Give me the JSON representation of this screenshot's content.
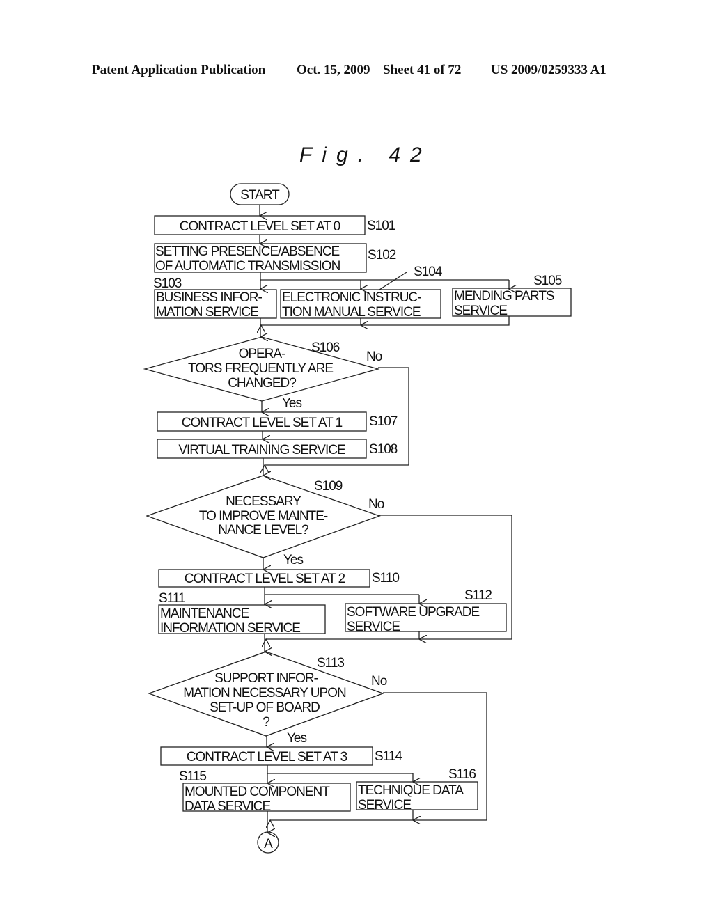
{
  "header": {
    "left": "Patent Application Publication",
    "date": "Oct. 15, 2009",
    "sheet": "Sheet 41 of 72",
    "number": "US 2009/0259333 A1"
  },
  "figure": {
    "title": "Fig. 42"
  },
  "flow": {
    "start": "START",
    "s101": {
      "id": "S101",
      "text": "CONTRACT LEVEL SET AT 0"
    },
    "s102": {
      "id": "S102",
      "lines": [
        "SETTING PRESENCE/ABSENCE",
        "OF AUTOMATIC TRANSMISSION"
      ]
    },
    "s103": {
      "id": "S103",
      "lines": [
        "BUSINESS INFOR-",
        "MATION SERVICE"
      ]
    },
    "s104": {
      "id": "S104",
      "lines": [
        "ELECTRONIC INSTRUC-",
        "TION MANUAL SERVICE"
      ]
    },
    "s105": {
      "id": "S105",
      "lines": [
        "MENDING PARTS",
        "SERVICE"
      ]
    },
    "s106": {
      "id": "S106",
      "lines": [
        "OPERA-",
        "TORS FREQUENTLY ARE",
        "CHANGED?"
      ],
      "yes": "Yes",
      "no": "No"
    },
    "s107": {
      "id": "S107",
      "text": "CONTRACT LEVEL SET AT 1"
    },
    "s108": {
      "id": "S108",
      "text": "VIRTUAL TRAINING SERVICE"
    },
    "s109": {
      "id": "S109",
      "lines": [
        "NECESSARY",
        "TO IMPROVE MAINTE-",
        "NANCE LEVEL?"
      ],
      "yes": "Yes",
      "no": "No"
    },
    "s110": {
      "id": "S110",
      "text": "CONTRACT LEVEL SET AT 2"
    },
    "s111": {
      "id": "S111",
      "lines": [
        "MAINTENANCE",
        "INFORMATION SERVICE"
      ]
    },
    "s112": {
      "id": "S112",
      "lines": [
        "SOFTWARE UPGRADE",
        "SERVICE"
      ]
    },
    "s113": {
      "id": "S113",
      "lines": [
        "SUPPORT INFOR-",
        "MATION NECESSARY UPON",
        "SET-UP OF BOARD",
        "?"
      ],
      "yes": "Yes",
      "no": "No"
    },
    "s114": {
      "id": "S114",
      "text": "CONTRACT LEVEL SET AT 3"
    },
    "s115": {
      "id": "S115",
      "lines": [
        "MOUNTED COMPONENT",
        "DATA SERVICE"
      ]
    },
    "s116": {
      "id": "S116",
      "lines": [
        "TECHNIQUE DATA",
        "SERVICE"
      ]
    },
    "connector": "A"
  }
}
